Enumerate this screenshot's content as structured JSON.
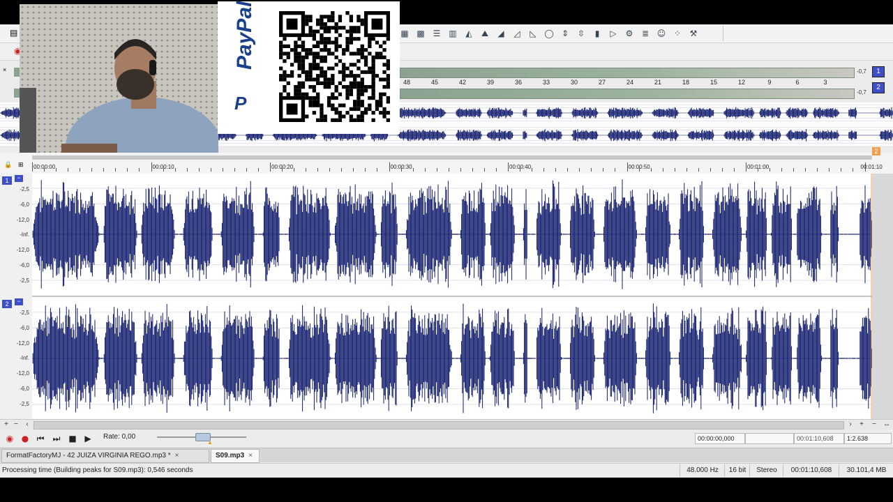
{
  "toolbar": {
    "icons": [
      "grid-icon",
      "colorful-grid-icon",
      "list-icon",
      "bar-chart-icon",
      "area-chart-icon",
      "mountain-chart-icon",
      "ramp-up-icon",
      "fade-in-icon",
      "fade-out-icon",
      "circle-icon",
      "vertical-arrows-icon",
      "split-icon",
      "bars-icon",
      "play-icon",
      "gear-icon",
      "stack-icon",
      "person-icon",
      "dots-icon",
      "tool-icon"
    ]
  },
  "meter": {
    "channel1_badge": "1",
    "channel2_badge": "2",
    "channel1_peak": "-0,7",
    "channel2_peak": "-0,7",
    "scale": [
      "48",
      "45",
      "42",
      "39",
      "36",
      "33",
      "30",
      "27",
      "24",
      "21",
      "18",
      "15",
      "12",
      "9",
      "6",
      "3"
    ]
  },
  "timeline": {
    "labels": [
      "00:00:00",
      "00:00:10",
      "00:00:20",
      "00:00:30",
      "00:00:40",
      "00:00:50",
      "00:01:00",
      "00:01:10"
    ],
    "end_marker": "2"
  },
  "tracks": [
    {
      "badge": "1",
      "minus": "−",
      "db_labels": [
        "-2,5",
        "-6,0",
        "-12,0",
        "-Inf.",
        "-12,0",
        "-6,0",
        "-2,5"
      ]
    },
    {
      "badge": "2",
      "minus": "−",
      "db_labels": [
        "-2,5",
        "-6,0",
        "-12,0",
        "-Inf.",
        "-12,0",
        "-6,0",
        "-2,5"
      ]
    }
  ],
  "colors": {
    "waveform": "#0f1a6b",
    "badge": "#3c4ec8",
    "paypal": "#1a3f8c"
  },
  "transport": {
    "rate": "Rate: 0,00",
    "cursor_time": "00:00:00,000",
    "selection_length": "00:01:10,608",
    "zoom": "1:2.638"
  },
  "tabs": [
    {
      "label": "FormatFactoryMJ - 42 JUIZA VIRGINIA REGO.mp3 *",
      "close": "×"
    },
    {
      "label": "S09.mp3",
      "close": "×"
    }
  ],
  "status": {
    "message": "Processing time (Building peaks for S09.mp3): 0,546 seconds",
    "sample_rate": "48.000 Hz",
    "bit_depth": "16 bit",
    "channels": "Stereo",
    "duration": "00:01:10,608",
    "size": "30.101,4 MB"
  },
  "overlay": {
    "paypal_text": "PayPal"
  }
}
